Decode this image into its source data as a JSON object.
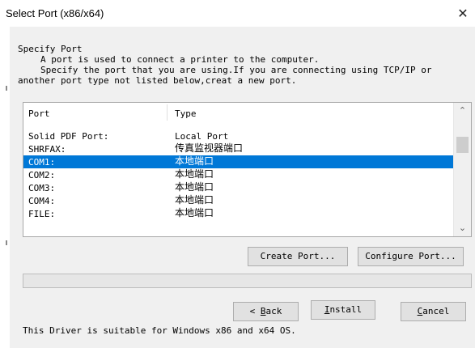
{
  "window": {
    "title": "Select Port (x86/x64)",
    "close_glyph": "✕"
  },
  "header": {
    "heading": "Specify Port",
    "line1": "A port is used to connect a printer to the computer.",
    "line2": "Specify the port that you are using.If you are connecting using TCP/IP or",
    "line3": "another port type not listed below,creat a new port."
  },
  "port_list": {
    "columns": [
      "Port",
      "Type"
    ],
    "selected_index": 2,
    "rows": [
      {
        "port": "Solid PDF Port:",
        "type": "Local Port"
      },
      {
        "port": "SHRFAX:",
        "type": "传真监视器端口"
      },
      {
        "port": "COM1:",
        "type": "本地端口"
      },
      {
        "port": "COM2:",
        "type": "本地端口"
      },
      {
        "port": "COM3:",
        "type": "本地端口"
      },
      {
        "port": "COM4:",
        "type": "本地端口"
      },
      {
        "port": "FILE:",
        "type": "本地端口"
      }
    ],
    "scroll_up_glyph": "⌃",
    "scroll_down_glyph": "⌄"
  },
  "buttons": {
    "create_port": "Create Port...",
    "configure_port": "Configure Port...",
    "back_prefix": "< ",
    "back_mnemonic": "B",
    "back_rest": "ack",
    "install_mnemonic": "I",
    "install_rest": "nstall",
    "cancel_mnemonic": "C",
    "cancel_rest": "ancel"
  },
  "progress": {
    "value": 0
  },
  "footer": {
    "note": "This Driver is suitable for Windows x86 and x64 OS."
  },
  "colors": {
    "selection": "#0078d7",
    "button_face": "#e1e1e1",
    "dialog_bg": "#f0f0f0"
  }
}
